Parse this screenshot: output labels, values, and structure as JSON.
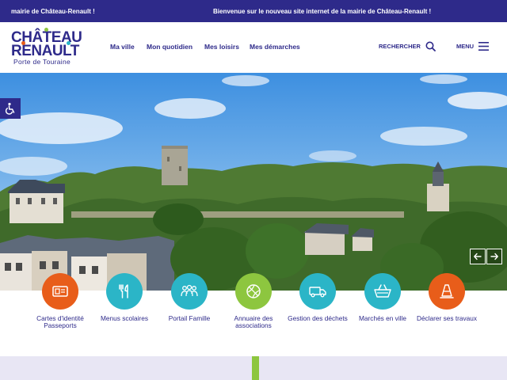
{
  "ticker": {
    "item1": "mairie de Château-Renault !",
    "item2": "Bienvenue sur le nouveau site internet de la mairie de Château-Renault !"
  },
  "logo": {
    "line1": "CHÂTEAU",
    "line2": "RENAULT",
    "tagline": "Porte de Touraine",
    "colors": [
      "#2e2a8a",
      "#8dc63f",
      "#e85d1a",
      "#2bb5c7"
    ]
  },
  "nav": {
    "items": [
      "Ma ville",
      "Mon quotidien",
      "Mes loisirs",
      "Mes démarches"
    ],
    "search_label": "RECHERCHER",
    "menu_label": "MENU"
  },
  "shortcuts": [
    {
      "label": "Cartes d'identité Passeports",
      "color": "#e85d1a",
      "icon": "id-card-icon"
    },
    {
      "label": "Menus scolaires",
      "color": "#2bb5c7",
      "icon": "cutlery-icon"
    },
    {
      "label": "Portail Famille",
      "color": "#2bb5c7",
      "icon": "family-icon"
    },
    {
      "label": "Annuaire des associations",
      "color": "#8dc63f",
      "icon": "ball-icon"
    },
    {
      "label": "Gestion des déchets",
      "color": "#2bb5c7",
      "icon": "truck-icon"
    },
    {
      "label": "Marchés en ville",
      "color": "#2bb5c7",
      "icon": "basket-icon"
    },
    {
      "label": "Déclarer ses travaux",
      "color": "#e85d1a",
      "icon": "cone-icon"
    }
  ],
  "colors": {
    "brand": "#2e2a8a",
    "green": "#8dc63f",
    "orange": "#e85d1a",
    "teal": "#2bb5c7"
  }
}
